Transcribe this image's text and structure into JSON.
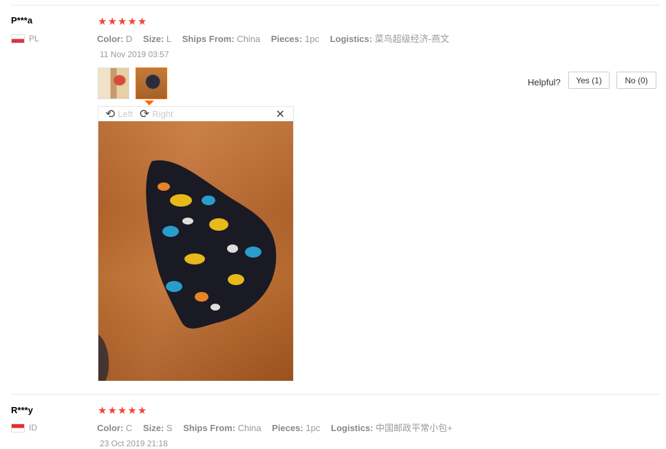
{
  "reviews": [
    {
      "user": "P***a",
      "country": "PL",
      "rating_stars": 5,
      "attrs": [
        {
          "key": "Color:",
          "value": "D"
        },
        {
          "key": "Size:",
          "value": "L"
        },
        {
          "key": "Ships From:",
          "value": "China"
        },
        {
          "key": "Pieces:",
          "value": "1pc"
        },
        {
          "key": "Logistics:",
          "value": "菜鸟超级经济-燕文"
        }
      ],
      "date": "11 Nov 2019 03:57",
      "helpful_label": "Helpful?",
      "yes_label": "Yes (1)",
      "no_label": "No (0)",
      "viewer": {
        "left_label": "Left",
        "right_label": "Right",
        "close_glyph": "✕"
      }
    },
    {
      "user": "R***y",
      "country": "ID",
      "rating_stars": 5,
      "attrs": [
        {
          "key": "Color:",
          "value": "C"
        },
        {
          "key": "Size:",
          "value": "S"
        },
        {
          "key": "Ships From:",
          "value": "China"
        },
        {
          "key": "Pieces:",
          "value": "1pc"
        },
        {
          "key": "Logistics:",
          "value": "中国邮政平常小包+"
        }
      ],
      "date": "23 Oct 2019 21:18"
    }
  ],
  "icons": {
    "star": "★",
    "rotate_left": "⟲",
    "rotate_right": "⟳"
  },
  "colors": {
    "star": "#f44336",
    "selected_border": "#ff6a00"
  }
}
